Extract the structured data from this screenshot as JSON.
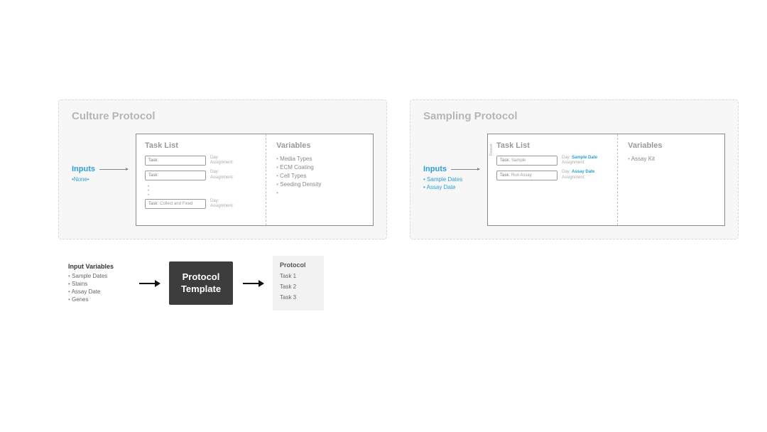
{
  "protocols": {
    "culture": {
      "title": "Culture Protocol",
      "inputs_label": "Inputs",
      "inputs_none": "•None•",
      "tasklist_heading": "Task List",
      "task_label": "Task:",
      "tasks": [
        {
          "name": "",
          "side1": "Day:",
          "side2": "Assignment:"
        },
        {
          "name": "",
          "side1": "Day:",
          "side2": "Assignment:"
        }
      ],
      "final_task": {
        "name": "Collect and Fixed",
        "side1": "Day:",
        "side2": "Assignment:"
      },
      "vars_heading": "Variables",
      "variables": [
        "Media Types",
        "ECM Coating",
        "Cell Types",
        "Seeding Density",
        ""
      ]
    },
    "sampling": {
      "title": "Sampling Protocol",
      "inputs_label": "Inputs",
      "inputs": [
        "Sample Dates",
        "Assay Date"
      ],
      "tasklist_heading": "Task List",
      "task_label": "Task:",
      "repeat_note": "Repeat",
      "tasks": [
        {
          "name": "Sample",
          "side1": "Day:",
          "side1v": "Sample Date",
          "side2": "Assignment:"
        },
        {
          "name": "Run Assay",
          "side1": "Day:",
          "side1v": "Assay Date",
          "side2": "Assignment:"
        }
      ],
      "vars_heading": "Variables",
      "variables": [
        "Assay Kit"
      ]
    }
  },
  "flow": {
    "input_variables_title": "Input Variables",
    "input_variables": [
      "Sample Dates",
      "Stains",
      "Assay Date",
      "Genes"
    ],
    "template_label_line1": "Protocol",
    "template_label_line2": "Template",
    "output_title": "Protocol",
    "output_tasks": [
      "Task 1",
      "Task 2",
      "Task 3"
    ]
  }
}
